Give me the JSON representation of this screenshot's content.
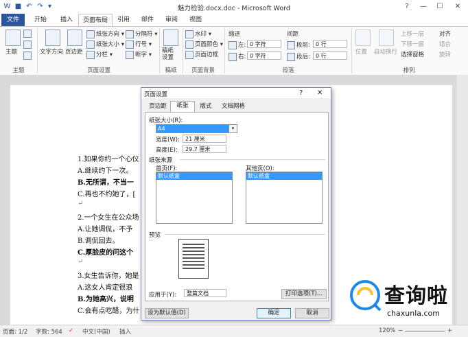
{
  "window": {
    "title": "魅力检验.docx.doc - Microsoft Word",
    "controls": [
      "?",
      "—",
      "☐",
      "✕"
    ]
  },
  "tabs": [
    "文件",
    "开始",
    "插入",
    "页面布局",
    "引用",
    "邮件",
    "审阅",
    "视图"
  ],
  "ribbon": {
    "themes_label": "主题",
    "theme_btn": "主题",
    "page_setup": {
      "text_direction": "文字方向",
      "margins": "页边距",
      "orientation": "纸张方向",
      "size": "纸张大小",
      "columns": "分栏",
      "breaks": "分隔符",
      "line_numbers": "行号",
      "hyphenation": "断字",
      "group_label": "页面设置"
    },
    "draft": {
      "btn": "稿纸设置",
      "group_label": "稿纸"
    },
    "background": {
      "watermark": "水印",
      "page_color": "页面颜色",
      "page_borders": "页面边框",
      "group_label": "页面背景"
    },
    "paragraph": {
      "indent_label": "缩进",
      "spacing_label": "间距",
      "left_label": "左:",
      "right_label": "右:",
      "before_label": "段前:",
      "after_label": "段后:",
      "left_value": "0 字符",
      "right_value": "0 字符",
      "before_value": "0 行",
      "after_value": "0 行",
      "group_label": "段落"
    },
    "arrange": {
      "position": "位置",
      "wrap": "自动换行",
      "bring_forward": "上移一层",
      "send_backward": "下移一层",
      "selection_pane": "选择窗格",
      "align": "对齐",
      "group": "组合",
      "rotate": "旋转",
      "group_label": "排列"
    }
  },
  "document": {
    "lines": [
      {
        "text": "1.如果你约一个心仪",
        "bold": false
      },
      {
        "text": "A.继续约下一次。",
        "bold": false
      },
      {
        "text": "B.无所谓，不当一",
        "bold": true
      },
      {
        "text": "C.再也不约她了，[",
        "bold": false
      },
      {
        "text": "↵",
        "bold": false
      },
      {
        "text": "2.一个女生在公众场",
        "bold": false
      },
      {
        "text": "A.让她调侃，不予",
        "bold": false
      },
      {
        "text": "B.调侃回去。",
        "bold": false
      },
      {
        "text": "C.厚脸皮的问这个",
        "bold": true
      },
      {
        "text": "↵",
        "bold": false
      },
      {
        "text": "3.女生告诉你，她是",
        "bold": false
      },
      {
        "text": "A.这女人肯定很浪",
        "bold": false
      },
      {
        "text": "B.为她高兴，说明",
        "bold": true
      },
      {
        "text": "C.会有点吃醋，为什",
        "bold": false
      }
    ]
  },
  "dialog": {
    "title": "页面设置",
    "help": "?",
    "close": "✕",
    "tabs": [
      "页边距",
      "纸张",
      "版式",
      "文档网格"
    ],
    "paper_size_label": "纸张大小(R):",
    "paper_size_value": "A4",
    "width_label": "宽度(W):",
    "width_value": "21 厘米",
    "height_label": "高度(E):",
    "height_value": "29.7 厘米",
    "source_label": "纸张来源",
    "first_page_label": "首页(F):",
    "other_pages_label": "其他页(O):",
    "first_page_selected": "默认纸盒",
    "other_pages_selected": "默认纸盒",
    "preview_label": "预览",
    "apply_to_label": "应用于(Y):",
    "apply_to_value": "整篇文档",
    "print_options": "打印选项(T)...",
    "set_default": "设为默认值(D)",
    "ok": "确定",
    "cancel": "取消"
  },
  "status": {
    "page": "页面: 1/2",
    "words": "字数: 564",
    "language": "中文(中国)",
    "mode": "插入",
    "zoom": "120%"
  },
  "watermark": {
    "brand": "查询啦",
    "url": "chaxunla.com"
  },
  "colors": {
    "accent": "#2b579a",
    "selection": "#3399ff"
  }
}
